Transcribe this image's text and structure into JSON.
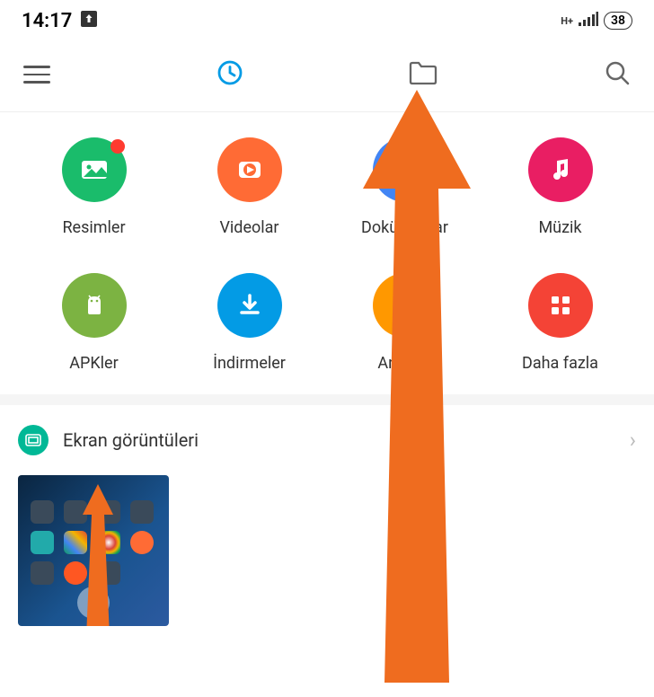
{
  "status": {
    "time": "14:17",
    "battery": "38"
  },
  "categories": [
    {
      "label": "Resimler",
      "color": "#1abc6b",
      "icon": "image",
      "badge": true
    },
    {
      "label": "Videolar",
      "color": "#ff6b35",
      "icon": "video",
      "badge": false
    },
    {
      "label": "Dokümanlar",
      "color": "#4285f4",
      "icon": "doc",
      "badge": false
    },
    {
      "label": "Müzik",
      "color": "#e91e63",
      "icon": "music",
      "badge": false
    },
    {
      "label": "APKler",
      "color": "#7cb342",
      "icon": "apk",
      "badge": false
    },
    {
      "label": "İndirmeler",
      "color": "#039be5",
      "icon": "download",
      "badge": false
    },
    {
      "label": "Arşivler",
      "color": "#ff9800",
      "icon": "zip",
      "badge": false
    },
    {
      "label": "Daha fazla",
      "color": "#f44336",
      "icon": "more",
      "badge": false
    }
  ],
  "section": {
    "title": "Ekran görüntüleri"
  }
}
